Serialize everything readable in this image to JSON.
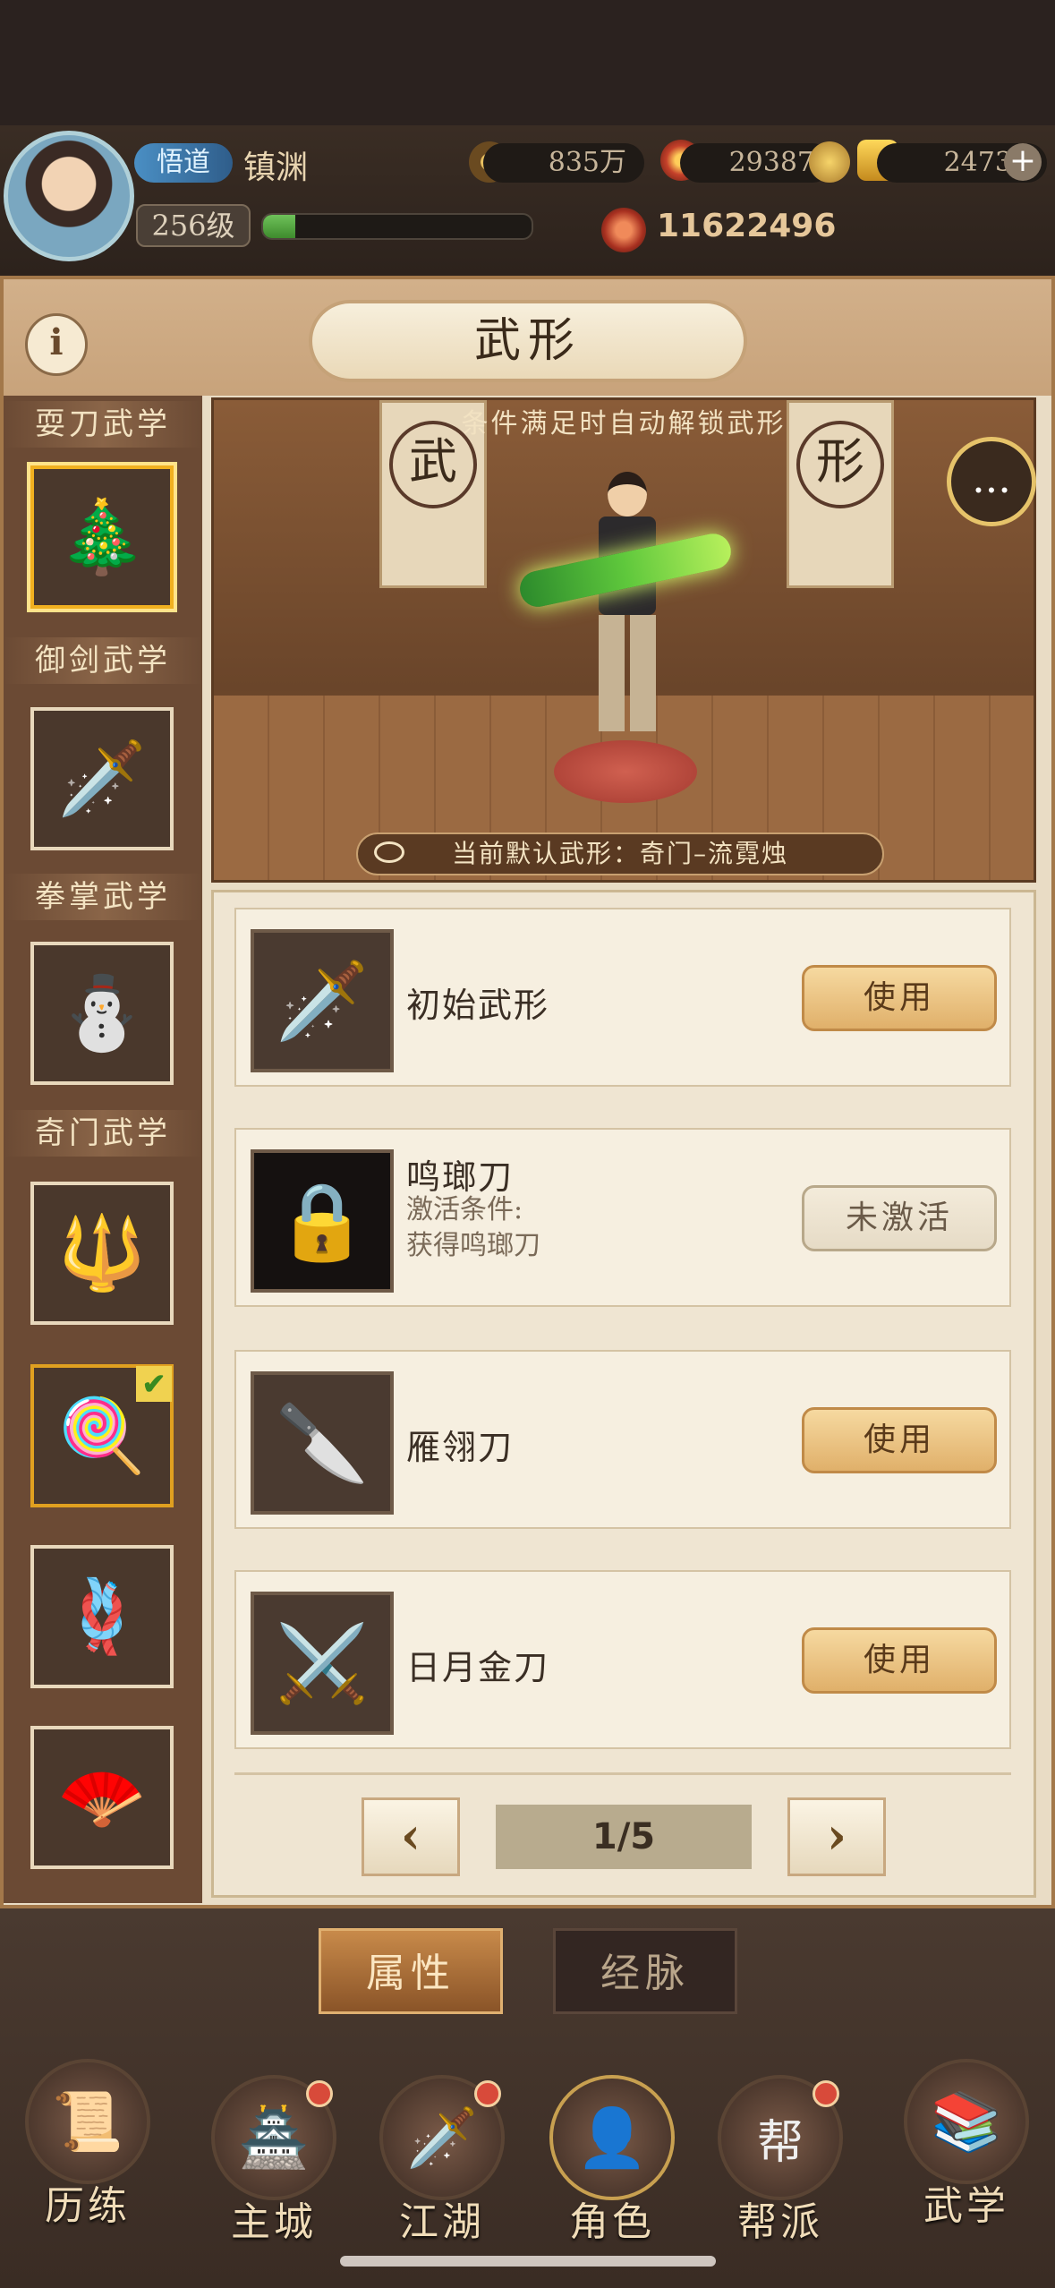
{
  "player": {
    "rank": "悟道",
    "name": "镇渊",
    "level": "256级",
    "exp_fraction": 0.12,
    "silver": "835万",
    "gems": "29387",
    "gold": "24737",
    "power": "11622496"
  },
  "page": {
    "title": "武形",
    "info_icon": "info-icon"
  },
  "sidebar": {
    "categories": [
      "耍刀武学",
      "御剑武学",
      "拳掌武学",
      "奇门武学"
    ],
    "items": [
      {
        "icon": "🎄",
        "selected": true
      },
      {
        "icon": "🗡️",
        "selected": false
      },
      {
        "icon": "⛄",
        "selected": false
      },
      {
        "icon": "🔱",
        "selected": false
      },
      {
        "icon": "🍭",
        "selected": false,
        "checked": true
      },
      {
        "icon": "🪢",
        "selected": false
      },
      {
        "icon": "🪭",
        "selected": false
      }
    ],
    "check_mark": "✔"
  },
  "scene": {
    "hint": "条件满足时自动解锁武形",
    "banner_left": "武",
    "banner_right": "形",
    "current_form": "当前默认武形：奇门–流霓烛",
    "chat_icon": "..."
  },
  "forms": [
    {
      "name": "初始武形",
      "icon": "🗡️",
      "button": "使用",
      "locked": false
    },
    {
      "name": "鸣瑯刀",
      "icon": "🔒",
      "button": "未激活",
      "locked": true,
      "condition_label": "激活条件:",
      "condition": "获得鸣瑯刀"
    },
    {
      "name": "雁翎刀",
      "icon": "🔪",
      "button": "使用",
      "locked": false
    },
    {
      "name": "日月金刀",
      "icon": "⚔️",
      "button": "使用",
      "locked": false
    }
  ],
  "pager": {
    "prev": "‹",
    "next": "›",
    "page": "1/5"
  },
  "subtabs": [
    "属性",
    "经脉"
  ],
  "nav": [
    {
      "label": "历练",
      "icon": "📜",
      "dot": false
    },
    {
      "label": "主城",
      "icon": "🏯",
      "dot": true
    },
    {
      "label": "江湖",
      "icon": "🗡️",
      "dot": true
    },
    {
      "label": "角色",
      "icon": "👤",
      "dot": false
    },
    {
      "label": "帮派",
      "icon": "帮",
      "dot": true
    },
    {
      "label": "武学",
      "icon": "📚",
      "dot": false
    }
  ],
  "colors": {
    "accent_gold": "#e0b06a",
    "selected_border": "#f0b020",
    "notify_red": "#d84a3a"
  }
}
